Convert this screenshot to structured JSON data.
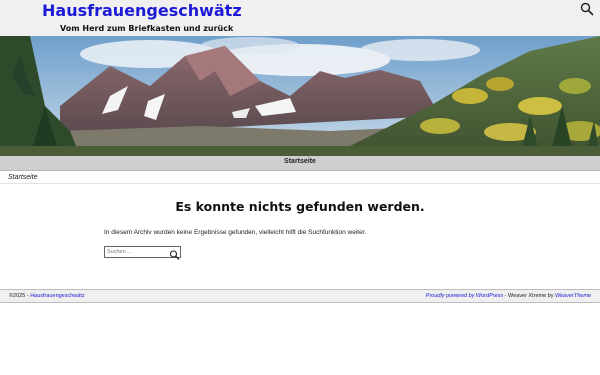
{
  "header": {
    "site_title": "Hausfrauengeschwätz",
    "tagline": "Vom Herd zum Briefkasten und zurück",
    "search_icon": "search-icon"
  },
  "nav": {
    "items": [
      {
        "label": "Startseite"
      }
    ]
  },
  "breadcrumb": {
    "label": "Startseite"
  },
  "content": {
    "title": "Es konnte nichts gefunden werden.",
    "message": "In diesem Archiv wurden keine Ergebnisse gefunden, vielleicht hilft die Suchfunktion weiter.",
    "search": {
      "placeholder": "Suchen ...",
      "value": "",
      "submit_icon": "search-icon"
    }
  },
  "footer": {
    "copyright": "©2025 -",
    "site_link": "Hausfrauengeschwätz",
    "powered_by": "Proudly powered by WordPress",
    "separator": "-",
    "theme_text": "Weaver Xtreme by",
    "theme_link": "WeaverTheme"
  },
  "colors": {
    "link": "#1c1ad6",
    "header_bg": "#f0f0f0",
    "nav_bg": "#cfcfcf"
  }
}
